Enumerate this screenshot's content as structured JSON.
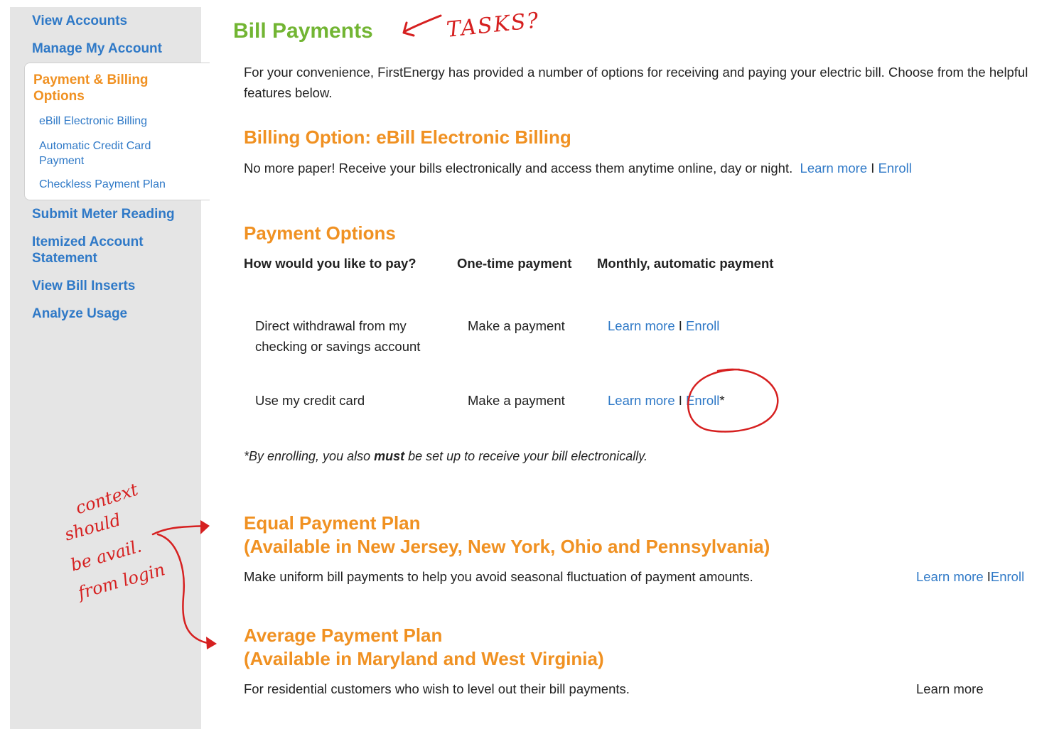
{
  "sidebar": {
    "top_items": [
      {
        "label": "View Accounts"
      },
      {
        "label": "Manage My Account"
      }
    ],
    "active_item": {
      "label": "Payment & Billing Options"
    },
    "sub_items": [
      {
        "label": "eBill Electronic Billing"
      },
      {
        "label": "Automatic Credit Card Payment"
      },
      {
        "label": "Checkless Payment Plan"
      }
    ],
    "bottom_items": [
      {
        "label": "Submit Meter Reading"
      },
      {
        "label": "Itemized Account Statement"
      },
      {
        "label": "View Bill Inserts"
      },
      {
        "label": "Analyze Usage"
      }
    ]
  },
  "page": {
    "title": "Bill Payments",
    "intro": "For your convenience, FirstEnergy has provided a number of options for receiving and paying your electric bill. Choose from the helpful features below."
  },
  "ebill": {
    "heading": "Billing Option: eBill Electronic Billing",
    "text": "No more paper! Receive your bills electronically and access them anytime online, day or night.",
    "learn_more": "Learn more",
    "separator": "I",
    "enroll": "Enroll"
  },
  "payment_options": {
    "heading": "Payment Options",
    "columns": [
      "How would you like to pay?",
      "One-time payment",
      "Monthly, automatic payment"
    ],
    "rows": [
      {
        "label": "Direct withdrawal from my checking or savings account",
        "make_payment": "Make a payment",
        "learn_more": "Learn more",
        "separator": "I",
        "enroll": "Enroll",
        "suffix": ""
      },
      {
        "label": "Use my credit card",
        "make_payment": "Make a payment",
        "learn_more": "Learn more",
        "separator": "I",
        "enroll": "Enroll",
        "suffix": "*"
      }
    ],
    "note_prefix": "*By enrolling, you also ",
    "note_bold": "must",
    "note_suffix": " be set up to receive your bill electronically."
  },
  "equal_plan": {
    "heading": "Equal Payment Plan",
    "subheading": "(Available in New Jersey, New York, Ohio and Pennsylvania)",
    "text": "Make uniform bill payments to help you avoid seasonal fluctuation of payment amounts.",
    "learn_more": "Learn more ",
    "separator": "I",
    "enroll": "Enroll"
  },
  "average_plan": {
    "heading": "Average Payment Plan",
    "subheading": "(Available in Maryland and West Virginia)",
    "text": "For residential customers who wish to level out their bill payments.",
    "learn_more": "Learn more"
  },
  "annotations": {
    "tasks": "TASKS?",
    "context": [
      "context",
      "should",
      "be avail.",
      "from login"
    ],
    "ink_color": "#d62020"
  },
  "colors": {
    "link": "#2f79c7",
    "orange": "#f09122",
    "green": "#72b533",
    "sidebar_bg": "#e5e5e5"
  }
}
